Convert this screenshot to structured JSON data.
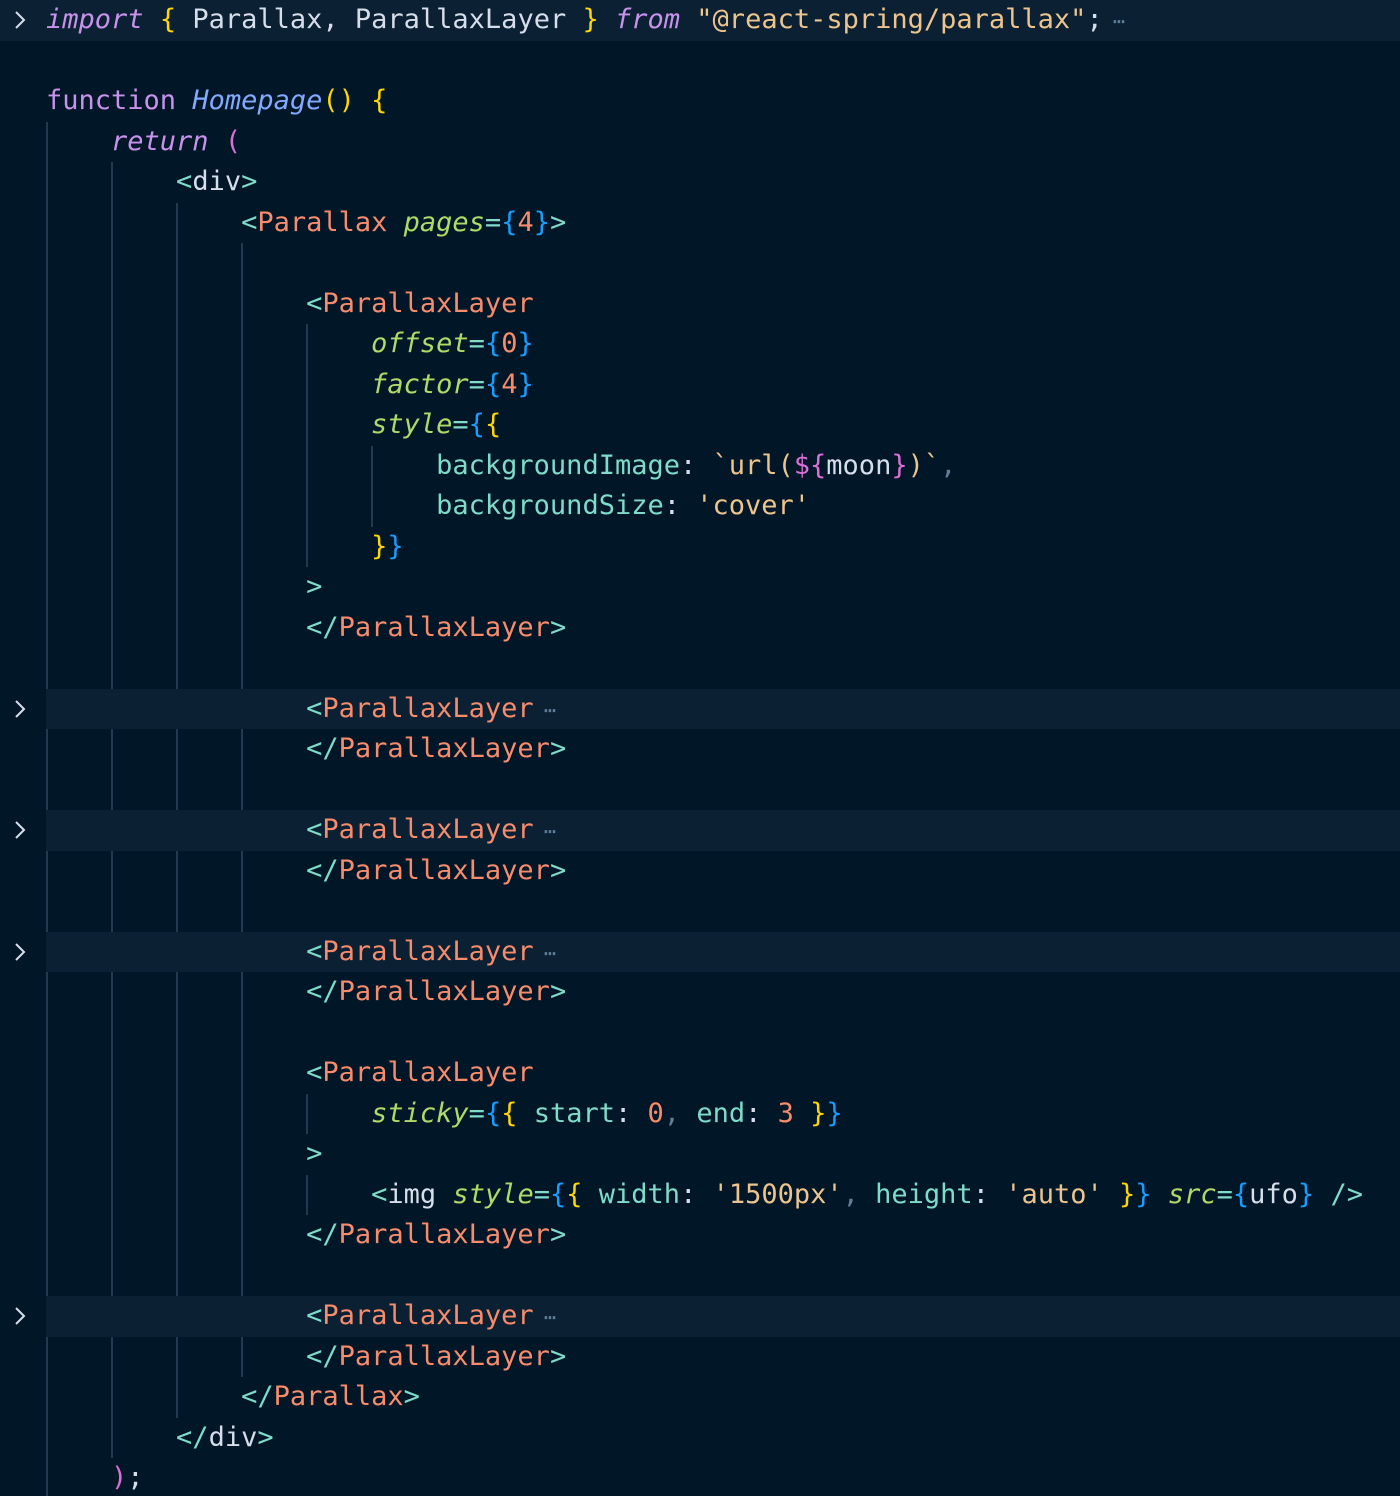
{
  "colors": {
    "background": "#011627",
    "folded_line": "#0b2033",
    "indent_guide": "#26374f",
    "keyword": "#c792ea",
    "function_name": "#82aaff",
    "brace": "#ffd700",
    "bracket_pink": "#da70d6",
    "bracket_blue": "#179fff",
    "tag": "#f78c6c",
    "tag_punct": "#7fdbca",
    "attribute": "#addb67",
    "property": "#7fdbca",
    "string": "#ecc48d",
    "number": "#f78c6c",
    "plain": "#d6deeb",
    "ellipsis": "#5f7e97",
    "fold_arrow": "#d6deeb"
  },
  "lines": [
    {
      "indent": 0,
      "fold": true,
      "highlight": "top",
      "tokens": [
        {
          "t": "import",
          "c": "keyword",
          "i": true
        },
        {
          "t": " ",
          "c": "plain"
        },
        {
          "t": "{",
          "c": "brace"
        },
        {
          "t": " Parallax, ParallaxLayer ",
          "c": "plain"
        },
        {
          "t": "}",
          "c": "brace"
        },
        {
          "t": " ",
          "c": "plain"
        },
        {
          "t": "from",
          "c": "keyword",
          "i": true
        },
        {
          "t": " ",
          "c": "plain"
        },
        {
          "t": "\"@react-spring/parallax\"",
          "c": "string"
        },
        {
          "t": ";",
          "c": "plain"
        }
      ],
      "ellipsis": "⋯"
    },
    {
      "indent": 0,
      "tokens": []
    },
    {
      "indent": 0,
      "tokens": [
        {
          "t": "function",
          "c": "keyword"
        },
        {
          "t": " ",
          "c": "plain"
        },
        {
          "t": "Homepage",
          "c": "function_name",
          "i": true
        },
        {
          "t": "()",
          "c": "brace"
        },
        {
          "t": " ",
          "c": "plain"
        },
        {
          "t": "{",
          "c": "brace"
        }
      ]
    },
    {
      "indent": 1,
      "tokens": [
        {
          "t": "return",
          "c": "keyword",
          "i": true
        },
        {
          "t": " ",
          "c": "plain"
        },
        {
          "t": "(",
          "c": "bracket_pink"
        }
      ]
    },
    {
      "indent": 2,
      "tokens": [
        {
          "t": "<",
          "c": "tag_punct"
        },
        {
          "t": "div",
          "c": "plain"
        },
        {
          "t": ">",
          "c": "tag_punct"
        }
      ]
    },
    {
      "indent": 3,
      "tokens": [
        {
          "t": "<",
          "c": "tag_punct"
        },
        {
          "t": "Parallax",
          "c": "tag"
        },
        {
          "t": " ",
          "c": "plain"
        },
        {
          "t": "pages",
          "c": "attribute",
          "i": true
        },
        {
          "t": "=",
          "c": "tag_punct"
        },
        {
          "t": "{",
          "c": "bracket_blue"
        },
        {
          "t": "4",
          "c": "number"
        },
        {
          "t": "}",
          "c": "bracket_blue"
        },
        {
          "t": ">",
          "c": "tag_punct"
        }
      ]
    },
    {
      "indent": 4,
      "tokens": []
    },
    {
      "indent": 4,
      "tokens": [
        {
          "t": "<",
          "c": "tag_punct"
        },
        {
          "t": "ParallaxLayer",
          "c": "tag"
        }
      ]
    },
    {
      "indent": 5,
      "tokens": [
        {
          "t": "offset",
          "c": "attribute",
          "i": true
        },
        {
          "t": "=",
          "c": "tag_punct"
        },
        {
          "t": "{",
          "c": "bracket_blue"
        },
        {
          "t": "0",
          "c": "number"
        },
        {
          "t": "}",
          "c": "bracket_blue"
        }
      ]
    },
    {
      "indent": 5,
      "tokens": [
        {
          "t": "factor",
          "c": "attribute",
          "i": true
        },
        {
          "t": "=",
          "c": "tag_punct"
        },
        {
          "t": "{",
          "c": "bracket_blue"
        },
        {
          "t": "4",
          "c": "number"
        },
        {
          "t": "}",
          "c": "bracket_blue"
        }
      ]
    },
    {
      "indent": 5,
      "tokens": [
        {
          "t": "style",
          "c": "attribute",
          "i": true
        },
        {
          "t": "=",
          "c": "tag_punct"
        },
        {
          "t": "{",
          "c": "bracket_blue"
        },
        {
          "t": "{",
          "c": "brace"
        }
      ]
    },
    {
      "indent": 6,
      "tokens": [
        {
          "t": "backgroundImage",
          "c": "property"
        },
        {
          "t": ": ",
          "c": "plain"
        },
        {
          "t": "`url(",
          "c": "string"
        },
        {
          "t": "${",
          "c": "bracket_pink"
        },
        {
          "t": "moon",
          "c": "plain"
        },
        {
          "t": "}",
          "c": "bracket_pink"
        },
        {
          "t": ")`",
          "c": "string"
        },
        {
          "t": ",",
          "c": "ellipsis"
        }
      ]
    },
    {
      "indent": 6,
      "tokens": [
        {
          "t": "backgroundSize",
          "c": "property"
        },
        {
          "t": ": ",
          "c": "plain"
        },
        {
          "t": "'cover'",
          "c": "string"
        }
      ]
    },
    {
      "indent": 5,
      "tokens": [
        {
          "t": "}",
          "c": "brace"
        },
        {
          "t": "}",
          "c": "bracket_blue"
        }
      ]
    },
    {
      "indent": 4,
      "tokens": [
        {
          "t": ">",
          "c": "tag_punct"
        }
      ]
    },
    {
      "indent": 4,
      "tokens": [
        {
          "t": "</",
          "c": "tag_punct"
        },
        {
          "t": "ParallaxLayer",
          "c": "tag"
        },
        {
          "t": ">",
          "c": "tag_punct"
        }
      ]
    },
    {
      "indent": 4,
      "tokens": []
    },
    {
      "indent": 4,
      "fold": true,
      "highlight": "row",
      "tokens": [
        {
          "t": "<",
          "c": "tag_punct"
        },
        {
          "t": "ParallaxLayer",
          "c": "tag"
        }
      ],
      "ellipsis": "⋯"
    },
    {
      "indent": 4,
      "tokens": [
        {
          "t": "</",
          "c": "tag_punct"
        },
        {
          "t": "ParallaxLayer",
          "c": "tag"
        },
        {
          "t": ">",
          "c": "tag_punct"
        }
      ]
    },
    {
      "indent": 4,
      "tokens": []
    },
    {
      "indent": 4,
      "fold": true,
      "highlight": "row",
      "tokens": [
        {
          "t": "<",
          "c": "tag_punct"
        },
        {
          "t": "ParallaxLayer",
          "c": "tag"
        }
      ],
      "ellipsis": "⋯"
    },
    {
      "indent": 4,
      "tokens": [
        {
          "t": "</",
          "c": "tag_punct"
        },
        {
          "t": "ParallaxLayer",
          "c": "tag"
        },
        {
          "t": ">",
          "c": "tag_punct"
        }
      ]
    },
    {
      "indent": 4,
      "tokens": []
    },
    {
      "indent": 4,
      "fold": true,
      "highlight": "row",
      "tokens": [
        {
          "t": "<",
          "c": "tag_punct"
        },
        {
          "t": "ParallaxLayer",
          "c": "tag"
        }
      ],
      "ellipsis": "⋯"
    },
    {
      "indent": 4,
      "tokens": [
        {
          "t": "</",
          "c": "tag_punct"
        },
        {
          "t": "ParallaxLayer",
          "c": "tag"
        },
        {
          "t": ">",
          "c": "tag_punct"
        }
      ]
    },
    {
      "indent": 4,
      "tokens": []
    },
    {
      "indent": 4,
      "tokens": [
        {
          "t": "<",
          "c": "tag_punct"
        },
        {
          "t": "ParallaxLayer",
          "c": "tag"
        }
      ]
    },
    {
      "indent": 5,
      "tokens": [
        {
          "t": "sticky",
          "c": "attribute",
          "i": true
        },
        {
          "t": "=",
          "c": "tag_punct"
        },
        {
          "t": "{",
          "c": "bracket_blue"
        },
        {
          "t": "{",
          "c": "brace"
        },
        {
          "t": " ",
          "c": "plain"
        },
        {
          "t": "start",
          "c": "property"
        },
        {
          "t": ": ",
          "c": "plain"
        },
        {
          "t": "0",
          "c": "number"
        },
        {
          "t": ",",
          "c": "ellipsis"
        },
        {
          "t": " ",
          "c": "plain"
        },
        {
          "t": "end",
          "c": "property"
        },
        {
          "t": ": ",
          "c": "plain"
        },
        {
          "t": "3",
          "c": "number"
        },
        {
          "t": " ",
          "c": "plain"
        },
        {
          "t": "}",
          "c": "brace"
        },
        {
          "t": "}",
          "c": "bracket_blue"
        }
      ]
    },
    {
      "indent": 4,
      "tokens": [
        {
          "t": ">",
          "c": "tag_punct"
        }
      ]
    },
    {
      "indent": 5,
      "tokens": [
        {
          "t": "<",
          "c": "tag_punct"
        },
        {
          "t": "img",
          "c": "plain"
        },
        {
          "t": " ",
          "c": "plain"
        },
        {
          "t": "style",
          "c": "attribute",
          "i": true
        },
        {
          "t": "=",
          "c": "tag_punct"
        },
        {
          "t": "{",
          "c": "bracket_blue"
        },
        {
          "t": "{",
          "c": "brace"
        },
        {
          "t": " ",
          "c": "plain"
        },
        {
          "t": "width",
          "c": "property"
        },
        {
          "t": ": ",
          "c": "plain"
        },
        {
          "t": "'1500px'",
          "c": "string"
        },
        {
          "t": ",",
          "c": "ellipsis"
        },
        {
          "t": " ",
          "c": "plain"
        },
        {
          "t": "height",
          "c": "property"
        },
        {
          "t": ": ",
          "c": "plain"
        },
        {
          "t": "'auto'",
          "c": "string"
        },
        {
          "t": " ",
          "c": "plain"
        },
        {
          "t": "}",
          "c": "brace"
        },
        {
          "t": "}",
          "c": "bracket_blue"
        },
        {
          "t": " ",
          "c": "plain"
        },
        {
          "t": "src",
          "c": "attribute",
          "i": true
        },
        {
          "t": "=",
          "c": "tag_punct"
        },
        {
          "t": "{",
          "c": "bracket_blue"
        },
        {
          "t": "ufo",
          "c": "plain"
        },
        {
          "t": "}",
          "c": "bracket_blue"
        },
        {
          "t": " ",
          "c": "plain"
        },
        {
          "t": "/>",
          "c": "tag_punct"
        }
      ]
    },
    {
      "indent": 4,
      "tokens": [
        {
          "t": "</",
          "c": "tag_punct"
        },
        {
          "t": "ParallaxLayer",
          "c": "tag"
        },
        {
          "t": ">",
          "c": "tag_punct"
        }
      ]
    },
    {
      "indent": 4,
      "tokens": []
    },
    {
      "indent": 4,
      "fold": true,
      "highlight": "row",
      "tokens": [
        {
          "t": "<",
          "c": "tag_punct"
        },
        {
          "t": "ParallaxLayer",
          "c": "tag"
        }
      ],
      "ellipsis": "⋯"
    },
    {
      "indent": 4,
      "tokens": [
        {
          "t": "</",
          "c": "tag_punct"
        },
        {
          "t": "ParallaxLayer",
          "c": "tag"
        },
        {
          "t": ">",
          "c": "tag_punct"
        }
      ]
    },
    {
      "indent": 3,
      "tokens": [
        {
          "t": "</",
          "c": "tag_punct"
        },
        {
          "t": "Parallax",
          "c": "tag"
        },
        {
          "t": ">",
          "c": "tag_punct"
        }
      ]
    },
    {
      "indent": 2,
      "tokens": [
        {
          "t": "</",
          "c": "tag_punct"
        },
        {
          "t": "div",
          "c": "plain"
        },
        {
          "t": ">",
          "c": "tag_punct"
        }
      ]
    },
    {
      "indent": 1,
      "tokens": [
        {
          "t": ")",
          "c": "bracket_pink"
        },
        {
          "t": ";",
          "c": "plain"
        }
      ]
    }
  ]
}
